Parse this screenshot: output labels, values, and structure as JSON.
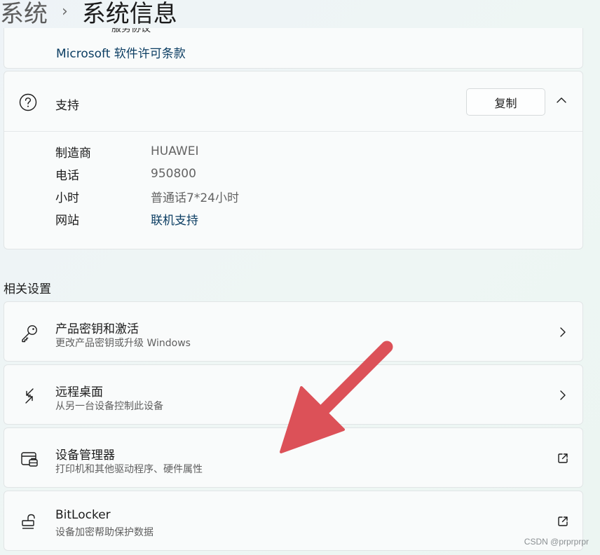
{
  "breadcrumb": {
    "parent": "系统",
    "separator": "›",
    "current": "系统信息"
  },
  "license": {
    "cut_text": "服务协议",
    "link": "Microsoft 软件许可条款"
  },
  "support": {
    "title": "支持",
    "copy_button": "复制",
    "rows": [
      {
        "key": "制造商",
        "value": "HUAWEI"
      },
      {
        "key": "电话",
        "value": "950800"
      },
      {
        "key": "小时",
        "value": "普通话7*24小时"
      },
      {
        "key": "网站",
        "value": "联机支持"
      }
    ]
  },
  "related": {
    "title": "相关设置",
    "items": [
      {
        "title": "产品密钥和激活",
        "subtitle": "更改产品密钥或升级 Windows",
        "icon": "key-icon",
        "tail": "chevron-right-icon"
      },
      {
        "title": "远程桌面",
        "subtitle": "从另一台设备控制此设备",
        "icon": "remote-desktop-icon",
        "tail": "chevron-right-icon"
      },
      {
        "title": "设备管理器",
        "subtitle": "打印机和其他驱动程序、硬件属性",
        "icon": "device-manager-icon",
        "tail": "external-link-icon"
      },
      {
        "title": "BitLocker",
        "subtitle": "设备加密帮助保护数据",
        "icon": "lock-icon",
        "tail": "external-link-icon"
      }
    ]
  },
  "annotation": {
    "arrow_color": "#dc5158"
  },
  "watermark": "CSDN @prprprpr"
}
